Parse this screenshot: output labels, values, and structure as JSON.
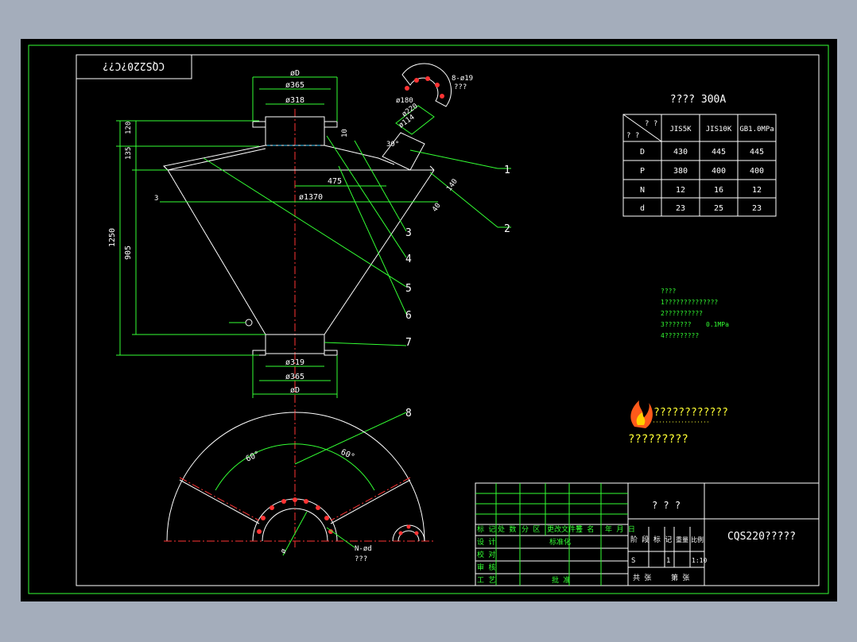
{
  "title_block_mirror": "CQS220?C??",
  "colors": {
    "background": "#000000",
    "frame": "#33ff33",
    "outline": "#ffffff",
    "dimension": "#33ff33",
    "centerline": "#ff3333",
    "highlight": "#ffff33"
  },
  "dimensions": {
    "top_phiD": "øD",
    "top_365": "ø365",
    "top_318": "ø318",
    "bottom_319": "ø319",
    "bottom_365": "ø365",
    "bottom_phiD": "øD",
    "d1370": "ø1370",
    "d475": "475",
    "h120": "120",
    "h135": "135",
    "h1250": "1250",
    "h905": "905",
    "h3": "3",
    "h10": "10",
    "nozzle_180": "ø180",
    "nozzle_220": "ø220",
    "nozzle_114": "ø114",
    "nozzle_30": "30°",
    "holes_8_19": "8-ø19",
    "holes_8_19_note": "???",
    "d140": "140",
    "d40": "40",
    "angle_60_left": "60°",
    "angle_60_right": "60°",
    "phi_small": "ø",
    "n_phid": "N-ød",
    "n_phid_note": "???"
  },
  "balloons": [
    "1",
    "2",
    "3",
    "4",
    "5",
    "6",
    "7",
    "8"
  ],
  "flange_table": {
    "title": "????  300A",
    "corner_top": "? ?",
    "corner_bottom": "? ?",
    "columns": [
      "JIS5K",
      "JIS10K",
      "GB1.0MPa"
    ],
    "rows": [
      {
        "label": "D",
        "values": [
          "430",
          "445",
          "445"
        ]
      },
      {
        "label": "P",
        "values": [
          "380",
          "400",
          "400"
        ]
      },
      {
        "label": "N",
        "values": [
          "12",
          "16",
          "12"
        ]
      },
      {
        "label": "d",
        "values": [
          "23",
          "25",
          "23"
        ]
      }
    ]
  },
  "notes": {
    "heading": "????",
    "lines": [
      "1??????????????",
      "2??????????",
      "3???????",
      "4?????????"
    ],
    "pressure": "0.1MPa"
  },
  "logo": {
    "line1": "????????????",
    "line2": "?????????"
  },
  "title_block": {
    "header_labels": [
      "标 记",
      "处 数",
      "分 区",
      "更改文件号",
      "签 名",
      "年 月 日"
    ],
    "row_design": "设 计",
    "row_standard": "标准化",
    "row_check": "校 对",
    "row_review": "审 核",
    "row_process": "工 艺",
    "row_approve": "批 准",
    "stage_label": "阶 段 标 记",
    "weight_label": "重量",
    "scale_label": "比例",
    "stage_value": "S",
    "weight_value": "1",
    "scale_value": "1:10",
    "sheet_total": "共  张",
    "sheet_no": "第  张",
    "material": "? ? ?",
    "drawing_name": "CQS220?????"
  }
}
